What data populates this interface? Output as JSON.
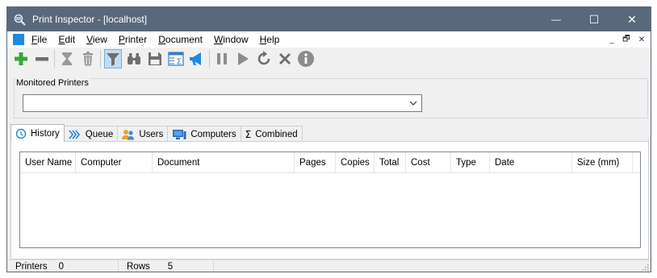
{
  "window": {
    "title": "Print Inspector - [localhost]",
    "controls": {
      "minimize": "—",
      "maximize": "☐",
      "close": "✕"
    }
  },
  "menu": {
    "items": [
      {
        "mnemonic": "F",
        "rest": "ile"
      },
      {
        "mnemonic": "E",
        "rest": "dit"
      },
      {
        "mnemonic": "V",
        "rest": "iew"
      },
      {
        "mnemonic": "P",
        "rest": "rinter"
      },
      {
        "mnemonic": "D",
        "rest": "ocument"
      },
      {
        "mnemonic": "W",
        "rest": "indow"
      },
      {
        "mnemonic": "H",
        "rest": "elp"
      }
    ],
    "mdi_controls": {
      "minimize": "_",
      "restore": "🗗",
      "close": "✕"
    }
  },
  "toolbar": {
    "buttons": [
      {
        "icon": "add-icon"
      },
      {
        "icon": "remove-icon"
      },
      {
        "icon": "hourglass-icon"
      },
      {
        "icon": "trash-icon"
      },
      {
        "icon": "filter-icon",
        "active": true
      },
      {
        "icon": "binoculars-icon"
      },
      {
        "icon": "save-icon"
      },
      {
        "icon": "sum-sheet-icon"
      },
      {
        "icon": "megaphone-icon"
      },
      {
        "icon": "pause-icon"
      },
      {
        "icon": "play-icon"
      },
      {
        "icon": "restart-icon"
      },
      {
        "icon": "cancel-icon"
      },
      {
        "icon": "info-icon"
      }
    ]
  },
  "monitored": {
    "label": "Monitored Printers",
    "value": ""
  },
  "tabs": [
    {
      "label": "History",
      "icon": "history-icon",
      "active": true
    },
    {
      "label": "Queue",
      "icon": "queue-icon"
    },
    {
      "label": "Users",
      "icon": "users-icon"
    },
    {
      "label": "Computers",
      "icon": "computers-icon"
    },
    {
      "label": "Combined",
      "icon": "sigma-icon"
    }
  ],
  "list": {
    "columns": [
      "User Name",
      "Computer",
      "Document",
      "Pages",
      "Copies",
      "Total",
      "Cost",
      "Type",
      "Date",
      "Size (mm)"
    ],
    "rows": []
  },
  "status": {
    "printers_label": "Printers",
    "printers_value": "0",
    "rows_label": "Rows",
    "rows_value": "5"
  },
  "colors": {
    "titlebar": "#59687a",
    "add": "#3aa63a",
    "accent": "#1e88e5"
  }
}
